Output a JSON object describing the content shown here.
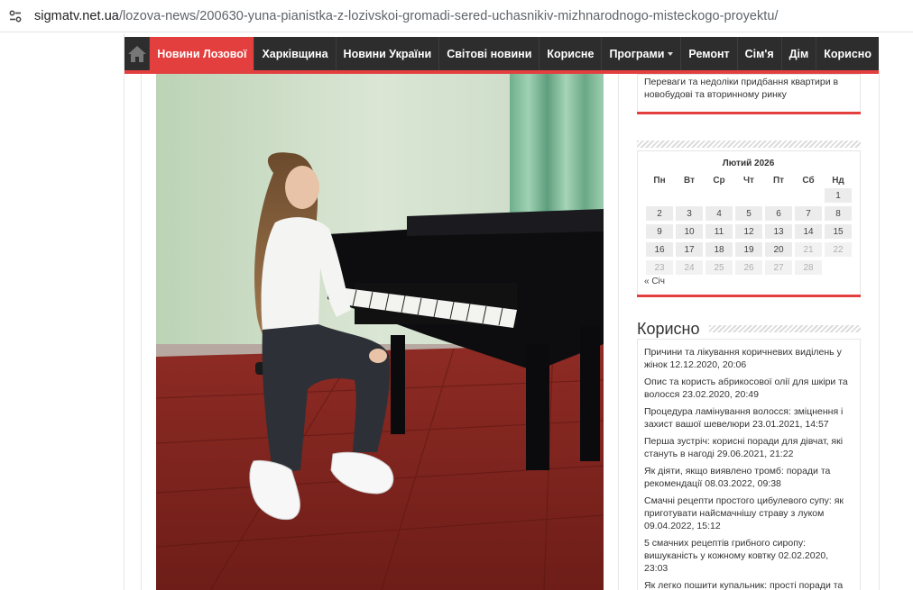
{
  "browser": {
    "url_host": "sigmatv.net.ua",
    "url_path": "/lozova-news/200630-yuna-pianistka-z-lozivskoi-gromadi-sered-uchasnikiv-mizhnarodnogo-misteckogo-proyektu/"
  },
  "nav": {
    "items": [
      {
        "label": "Новини Лозової",
        "active": true
      },
      {
        "label": "Харківщина"
      },
      {
        "label": "Новини України"
      },
      {
        "label": "Світові новини"
      },
      {
        "label": "Корисне"
      },
      {
        "label": "Програми"
      },
      {
        "label": "Ремонт"
      },
      {
        "label": "Сім'я"
      },
      {
        "label": "Дім"
      },
      {
        "label": "Корисно"
      }
    ]
  },
  "top_widget": {
    "text": "Переваги та недоліки придбання квартири в новобудові та вторинному ринку"
  },
  "calendar": {
    "title": "Лютий 2026",
    "weekdays": [
      "Пн",
      "Вт",
      "Ср",
      "Чт",
      "Пт",
      "Сб",
      "Нд"
    ],
    "days": [
      "1",
      "2",
      "3",
      "4",
      "5",
      "6",
      "7",
      "8",
      "9",
      "10",
      "11",
      "12",
      "13",
      "14",
      "15",
      "16",
      "17",
      "18",
      "19",
      "20",
      "21",
      "22",
      "23",
      "24",
      "25",
      "26",
      "27",
      "28"
    ],
    "prev_link": "« Січ"
  },
  "korysno": {
    "title": "Корисно",
    "items": [
      "Причини та лікування коричневих виділень у жінок 12.12.2020, 20:06",
      "Опис та користь абрикосової олії для шкіри та волосся 23.02.2020, 20:49",
      "Процедура ламінування волосся: зміцнення і захист вашої шевелюри 23.01.2021, 14:57",
      "Перша зустріч: корисні поради для дівчат, які стануть в нагоді 29.06.2021, 21:22",
      "Як діяти, якщо виявлено тромб: поради та рекомендації 08.03.2022, 09:38",
      "Смачні рецепти простого цибулевого супу: як приготувати найсмачнішу страву з луком 09.04.2022, 15:12",
      "5 смачних рецептів грибного сиропу: вишуканість у кожному ковтку 02.02.2020, 23:03",
      "Як легко пошити купальник: прості поради та"
    ]
  },
  "colors": {
    "accent": "#e43f3f",
    "nav_bg": "#2d2d2d"
  }
}
